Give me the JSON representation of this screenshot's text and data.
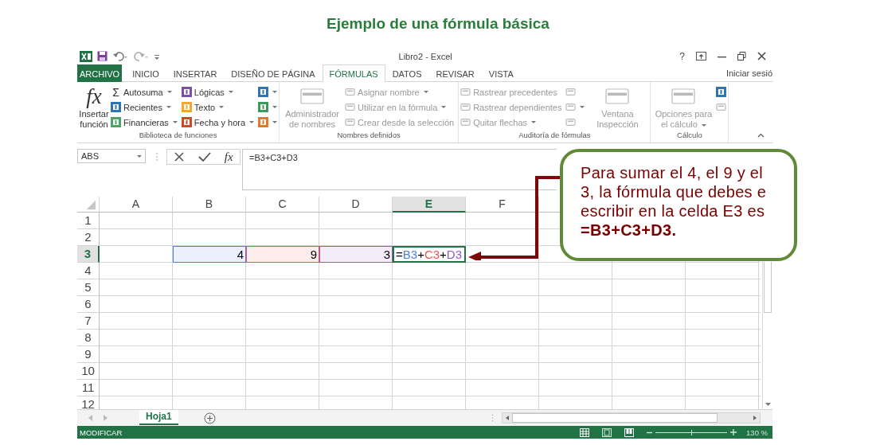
{
  "slide_title": "Ejemplo de una fórmula básica",
  "window": {
    "title": "Libro2 - Excel",
    "help": "?"
  },
  "tabs": [
    {
      "label": "ARCHIVO",
      "kind": "file",
      "selected": false
    },
    {
      "label": "INICIO",
      "kind": "tab",
      "selected": false
    },
    {
      "label": "INSERTAR",
      "kind": "tab",
      "selected": false
    },
    {
      "label": "DISEÑO DE PÁGINA",
      "kind": "tab",
      "selected": false
    },
    {
      "label": "FÓRMULAS",
      "kind": "tab",
      "selected": true
    },
    {
      "label": "DATOS",
      "kind": "tab",
      "selected": false
    },
    {
      "label": "REVISAR",
      "kind": "tab",
      "selected": false
    },
    {
      "label": "VISTA",
      "kind": "tab",
      "selected": false
    }
  ],
  "account": "Iniciar sesió",
  "ribbon": {
    "groups": [
      {
        "label": "Biblioteca de funciones",
        "columns": [
          [
            {
              "kind": "large",
              "glyph": "fx",
              "label": "Insertar función",
              "disabled": false
            }
          ],
          [
            {
              "kind": "small",
              "glyph": "Σ",
              "label": "Autosuma",
              "dropdown": true,
              "disabled": false
            },
            {
              "kind": "small",
              "color": "#2e75b6",
              "label": "Recientes",
              "dropdown": true,
              "disabled": false
            },
            {
              "kind": "small",
              "color": "#4aa564",
              "label": "Financieras",
              "dropdown": true,
              "disabled": false
            }
          ],
          [
            {
              "kind": "small",
              "color": "#7b4fa8",
              "label": "Lógicas",
              "dropdown": true,
              "disabled": false
            },
            {
              "kind": "small",
              "color": "#f0a830",
              "label": "Texto",
              "dropdown": true,
              "disabled": false
            },
            {
              "kind": "small",
              "color": "#d24726",
              "label": "Fecha y hora",
              "dropdown": true,
              "disabled": false
            }
          ],
          [
            {
              "kind": "icon",
              "color": "#2e75b6",
              "dropdown": true,
              "disabled": false
            },
            {
              "kind": "icon",
              "color": "#3a9a5a",
              "dropdown": true,
              "disabled": false
            },
            {
              "kind": "icon",
              "color": "#e87722",
              "dropdown": true,
              "disabled": false
            }
          ]
        ]
      },
      {
        "label": "Nombres definidos",
        "columns": [
          [
            {
              "kind": "large",
              "label": "Administrador de nombres",
              "disabled": true
            }
          ],
          [
            {
              "kind": "small",
              "label": "Asignar nombre",
              "dropdown": true,
              "disabled": true
            },
            {
              "kind": "small",
              "label": "Utilizar en la fórmula",
              "dropdown": true,
              "disabled": true
            },
            {
              "kind": "small",
              "label": "Crear desde la selección",
              "disabled": true
            }
          ]
        ]
      },
      {
        "label": "Auditoría de fórmulas",
        "columns": [
          [
            {
              "kind": "small",
              "label": "Rastrear precedentes",
              "disabled": true
            },
            {
              "kind": "small",
              "label": "Rastrear dependientes",
              "disabled": true
            },
            {
              "kind": "small",
              "label": "Quitar flechas",
              "dropdown": true,
              "disabled": true
            }
          ],
          [
            {
              "kind": "icon",
              "disabled": true
            },
            {
              "kind": "icon",
              "dropdown": true,
              "disabled": true
            },
            {
              "kind": "icon",
              "disabled": true
            }
          ],
          [
            {
              "kind": "large",
              "label": "Ventana Inspección",
              "disabled": true
            }
          ]
        ]
      },
      {
        "label": "Cálculo",
        "columns": [
          [
            {
              "kind": "large",
              "label": "Opciones para el cálculo",
              "dropdown": true,
              "disabled": true
            }
          ],
          [
            {
              "kind": "icon",
              "color": "#2e75b6",
              "disabled": false
            },
            {
              "kind": "icon",
              "disabled": true
            }
          ]
        ]
      }
    ]
  },
  "formula_bar": {
    "name_box": "ABS",
    "fx": "fx",
    "formula": "=B3+C3+D3"
  },
  "grid": {
    "columns": [
      {
        "label": "A",
        "selected": false
      },
      {
        "label": "B",
        "selected": false
      },
      {
        "label": "C",
        "selected": false
      },
      {
        "label": "D",
        "selected": false
      },
      {
        "label": "E",
        "selected": true
      },
      {
        "label": "F",
        "selected": false
      }
    ],
    "rows": [
      {
        "header": "1",
        "selected": false
      },
      {
        "header": "2",
        "selected": false
      },
      {
        "header": "3",
        "selected": true,
        "cells": [
          {},
          {
            "value": "4",
            "color": "#4a7fe0"
          },
          {
            "value": "9",
            "color": "#e85555"
          },
          {
            "value": "3",
            "color": "#8e5cc8"
          },
          {
            "selected": true,
            "parts": [
              {
                "text": "="
              },
              {
                "text": "B3",
                "color": "#4a7fe0"
              },
              {
                "text": "+"
              },
              {
                "text": "C3",
                "color": "#e85555"
              },
              {
                "text": "+"
              },
              {
                "text": "D3",
                "color": "#8e5cc8"
              }
            ]
          }
        ]
      },
      {
        "header": "4",
        "selected": false
      },
      {
        "header": "5",
        "selected": false
      },
      {
        "header": "6",
        "selected": false
      },
      {
        "header": "7",
        "selected": false
      },
      {
        "header": "8",
        "selected": false
      },
      {
        "header": "9",
        "selected": false
      },
      {
        "header": "10",
        "selected": false
      },
      {
        "header": "11",
        "selected": false
      },
      {
        "header": "12",
        "selected": false
      }
    ]
  },
  "sheet_tabs": [
    {
      "label": "Hoja1",
      "selected": true
    }
  ],
  "status_bar": {
    "mode": "MODIFICAR",
    "zoom": {
      "level": 0.5
    },
    "zoom_label": "130 %"
  },
  "callout": {
    "text": "Para sumar el 4, el 9 y el 3, la fórmula que debes e escribir en la celda E3 es **=B3+C3+D3.**"
  }
}
